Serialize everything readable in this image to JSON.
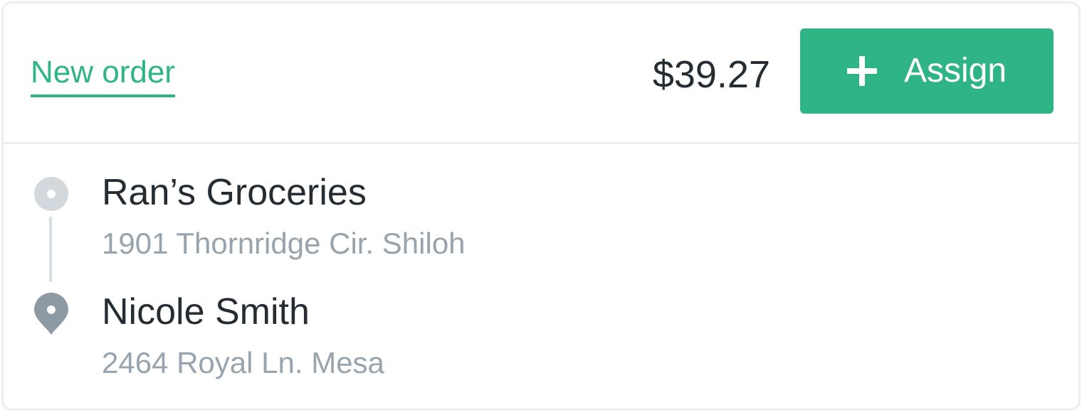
{
  "order": {
    "tab_label": "New order",
    "price": "$39.27",
    "assign_label": "Assign",
    "assign_icon": "plus-icon"
  },
  "pickup": {
    "icon": "pickup-dot-icon",
    "name": "Ran’s Groceries",
    "address": "1901 Thornridge Cir. Shiloh"
  },
  "dropoff": {
    "icon": "map-pin-icon",
    "name": "Nicole Smith",
    "address": "2464 Royal Ln. Mesa"
  },
  "colors": {
    "accent": "#2fb585",
    "text_primary": "#252d33",
    "text_secondary": "#97a3ad",
    "pickup_icon": "#d2d8dc",
    "dropoff_icon": "#8d99a3",
    "divider": "#eceff1"
  }
}
